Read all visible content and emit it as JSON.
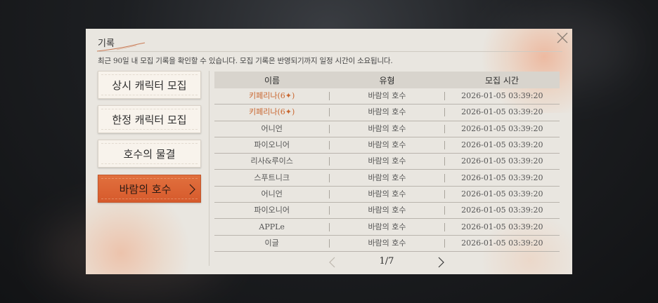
{
  "dialog": {
    "title": "기록",
    "subtitle": "최근 90일 내 모집 기록을 확인할 수 있습니다. 모집 기록은 반영되기까지 일정 시간이 소요됩니다."
  },
  "categories": [
    {
      "label": "상시 캐릭터 모집",
      "active": false
    },
    {
      "label": "한정 캐릭터 모집",
      "active": false
    },
    {
      "label": "호수의 물결",
      "active": false
    },
    {
      "label": "바람의 호수",
      "active": true
    }
  ],
  "table": {
    "headers": [
      "이름",
      "유형",
      "모집 시간"
    ],
    "rows": [
      {
        "name": "키페리나(6✦)",
        "type": "바람의 호수",
        "time": "2026-01-05 03:39:20",
        "highlight": true
      },
      {
        "name": "키페리나(6✦)",
        "type": "바람의 호수",
        "time": "2026-01-05 03:39:20",
        "highlight": true
      },
      {
        "name": "어니언",
        "type": "바람의 호수",
        "time": "2026-01-05 03:39:20",
        "highlight": false
      },
      {
        "name": "파이오니어",
        "type": "바람의 호수",
        "time": "2026-01-05 03:39:20",
        "highlight": false
      },
      {
        "name": "리사&루이스",
        "type": "바람의 호수",
        "time": "2026-01-05 03:39:20",
        "highlight": false
      },
      {
        "name": "스푸트니크",
        "type": "바람의 호수",
        "time": "2026-01-05 03:39:20",
        "highlight": false
      },
      {
        "name": "어니언",
        "type": "바람의 호수",
        "time": "2026-01-05 03:39:20",
        "highlight": false
      },
      {
        "name": "파이오니어",
        "type": "바람의 호수",
        "time": "2026-01-05 03:39:20",
        "highlight": false
      },
      {
        "name": "APPLe",
        "type": "바람의 호수",
        "time": "2026-01-05 03:39:20",
        "highlight": false
      },
      {
        "name": "이글",
        "type": "바람의 호수",
        "time": "2026-01-05 03:39:20",
        "highlight": false
      }
    ]
  },
  "pagination": {
    "label": "1/7"
  },
  "colors": {
    "accent": "#d9622f",
    "highlight_text": "#c9662f",
    "panel": "#e9e6e0"
  },
  "icons": {
    "close": "close-icon",
    "prev": "chevron-left-icon",
    "next": "chevron-right-icon",
    "category_arrow": "chevron-right-icon"
  }
}
